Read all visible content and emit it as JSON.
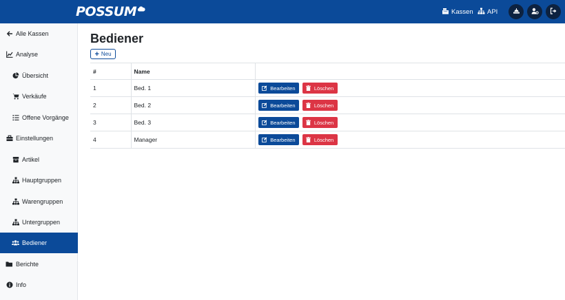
{
  "header": {
    "logo": "POSSUM",
    "links": [
      {
        "label": "Kassen",
        "icon": "cash-register-icon"
      },
      {
        "label": "API",
        "icon": "network-icon"
      }
    ],
    "buttons": [
      "hat-icon",
      "user-settings-icon",
      "logout-icon"
    ],
    "color": "#0b4a99"
  },
  "sidebar": {
    "items": [
      {
        "label": "Alle Kassen",
        "icon": "arrow-left-icon"
      },
      {
        "label": "Analyse",
        "icon": "chart-icon"
      },
      {
        "label": "Übersicht",
        "icon": "pie-chart-icon"
      },
      {
        "label": "Verkäufe",
        "icon": "cart-icon"
      },
      {
        "label": "Offene Vorgänge",
        "icon": "list-icon"
      },
      {
        "label": "Einstellungen",
        "icon": "toolbox-icon"
      },
      {
        "label": "Artikel",
        "icon": "box-icon"
      },
      {
        "label": "Hauptgruppen",
        "icon": "sitemap-icon"
      },
      {
        "label": "Warengruppen",
        "icon": "sitemap-icon"
      },
      {
        "label": "Untergruppen",
        "icon": "sitemap-icon"
      },
      {
        "label": "Bediener",
        "icon": "users-icon",
        "active": true
      },
      {
        "label": "Berichte",
        "icon": "folder-icon"
      },
      {
        "label": "Info",
        "icon": "info-icon"
      }
    ]
  },
  "main": {
    "title": "Bediener",
    "new_label": "Neu",
    "table": {
      "headers": [
        "#",
        "Name",
        ""
      ],
      "rows": [
        {
          "id": "1",
          "name": "Bed. 1"
        },
        {
          "id": "2",
          "name": "Bed. 2"
        },
        {
          "id": "3",
          "name": "Bed. 3"
        },
        {
          "id": "4",
          "name": "Manager"
        }
      ],
      "edit_label": "Bearbeiten",
      "delete_label": "Löschen"
    }
  },
  "colors": {
    "primary": "#0b4a99",
    "danger": "#dc3545"
  }
}
